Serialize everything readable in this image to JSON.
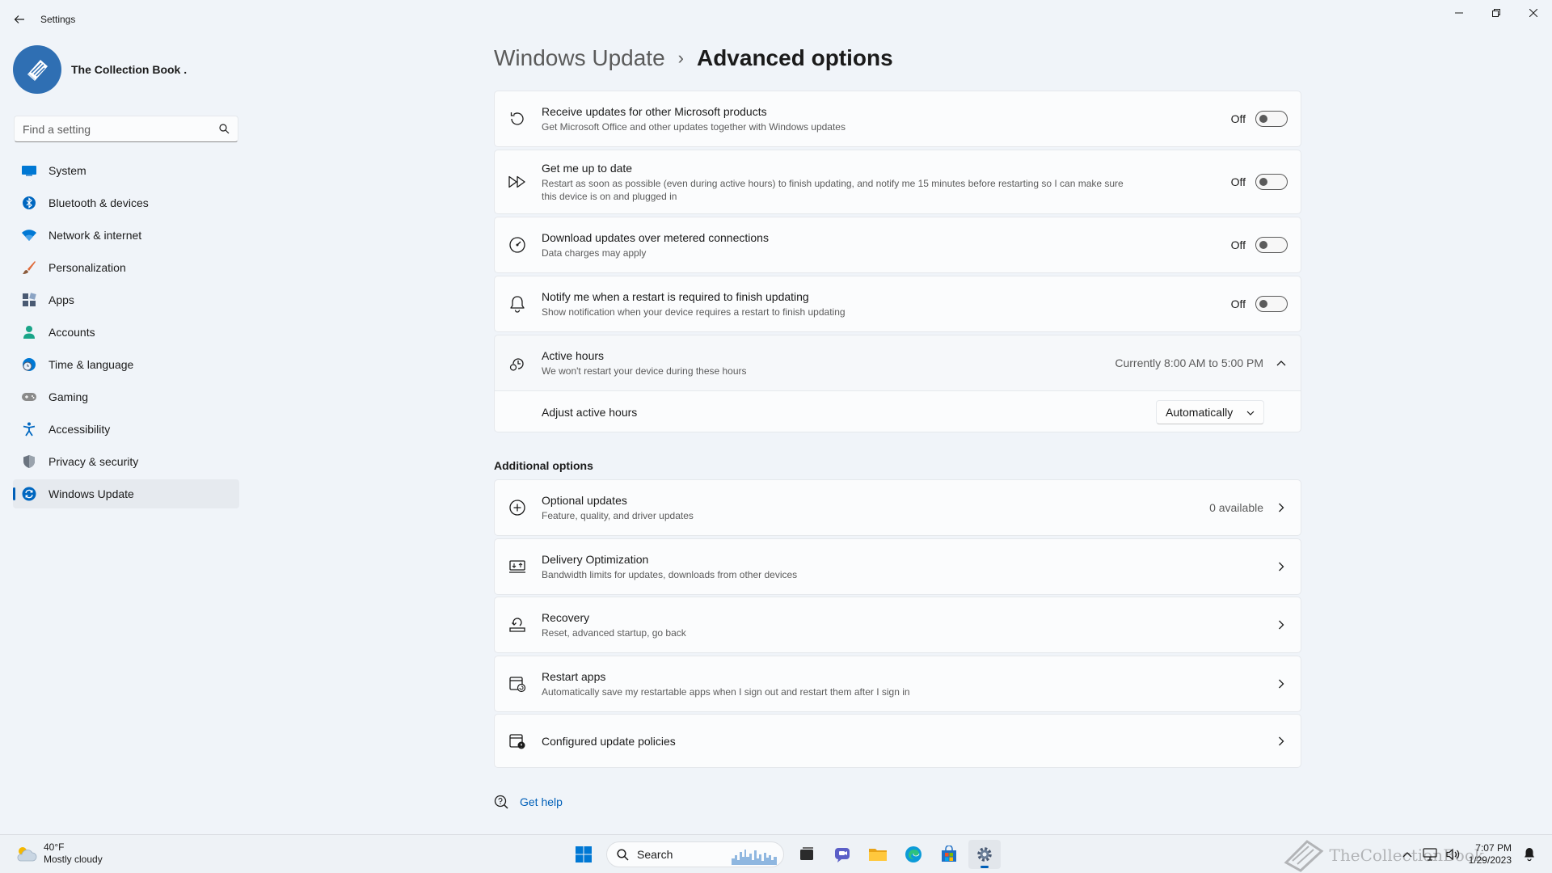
{
  "window": {
    "app_title": "Settings"
  },
  "profile": {
    "name": "The Collection Book ."
  },
  "search": {
    "placeholder": "Find a setting"
  },
  "sidebar": {
    "items": [
      {
        "label": "System",
        "icon": "monitor-icon",
        "color": "#0078d4"
      },
      {
        "label": "Bluetooth & devices",
        "icon": "bluetooth-icon",
        "color": "#0067c0"
      },
      {
        "label": "Network & internet",
        "icon": "wifi-icon",
        "color": "#0078d4"
      },
      {
        "label": "Personalization",
        "icon": "brush-icon",
        "color": "#e06c3c"
      },
      {
        "label": "Apps",
        "icon": "apps-icon",
        "color": "#4a5a73"
      },
      {
        "label": "Accounts",
        "icon": "person-icon",
        "color": "#1aa589"
      },
      {
        "label": "Time & language",
        "icon": "globe-clock-icon",
        "color": "#0078d4"
      },
      {
        "label": "Gaming",
        "icon": "gamepad-icon",
        "color": "#6b6b6b"
      },
      {
        "label": "Accessibility",
        "icon": "accessibility-icon",
        "color": "#0067c0"
      },
      {
        "label": "Privacy & security",
        "icon": "shield-icon",
        "color": "#6b7480"
      },
      {
        "label": "Windows Update",
        "icon": "sync-icon",
        "color": "#0067c0",
        "active": true
      }
    ]
  },
  "breadcrumb": {
    "parent": "Windows Update",
    "separator": "›",
    "current": "Advanced options"
  },
  "settings": [
    {
      "title": "Receive updates for other Microsoft products",
      "desc": "Get Microsoft Office and other updates together with Windows updates",
      "state": "Off",
      "icon": "refresh-icon"
    },
    {
      "title": "Get me up to date",
      "desc": "Restart as soon as possible (even during active hours) to finish updating, and notify me 15 minutes before restarting so I can make sure this device is on and plugged in",
      "state": "Off",
      "icon": "fast-forward-icon"
    },
    {
      "title": "Download updates over metered connections",
      "desc": "Data charges may apply",
      "state": "Off",
      "icon": "gauge-icon"
    },
    {
      "title": "Notify me when a restart is required to finish updating",
      "desc": "Show notification when your device requires a restart to finish updating",
      "state": "Off",
      "icon": "bell-icon"
    }
  ],
  "active_hours": {
    "title": "Active hours",
    "desc": "We won't restart your device during these hours",
    "current": "Currently 8:00 AM to 5:00 PM",
    "adjust_label": "Adjust active hours",
    "adjust_value": "Automatically"
  },
  "additional": {
    "heading": "Additional options",
    "items": [
      {
        "title": "Optional updates",
        "desc": "Feature, quality, and driver updates",
        "meta": "0 available",
        "icon": "plus-circle-icon"
      },
      {
        "title": "Delivery Optimization",
        "desc": "Bandwidth limits for updates, downloads from other devices",
        "meta": "",
        "icon": "delivery-icon"
      },
      {
        "title": "Recovery",
        "desc": "Reset, advanced startup, go back",
        "meta": "",
        "icon": "recovery-icon"
      },
      {
        "title": "Restart apps",
        "desc": "Automatically save my restartable apps when I sign out and restart them after I sign in",
        "meta": "",
        "icon": "restart-apps-icon"
      },
      {
        "title": "Configured update policies",
        "desc": "",
        "meta": "",
        "icon": "policy-icon"
      }
    ]
  },
  "help": {
    "label": "Get help"
  },
  "taskbar": {
    "weather_temp": "40°F",
    "weather_desc": "Mostly cloudy",
    "search_label": "Search",
    "time": "7:07 PM",
    "date": "1/29/2023",
    "watermark": "TheCollectionBook"
  }
}
